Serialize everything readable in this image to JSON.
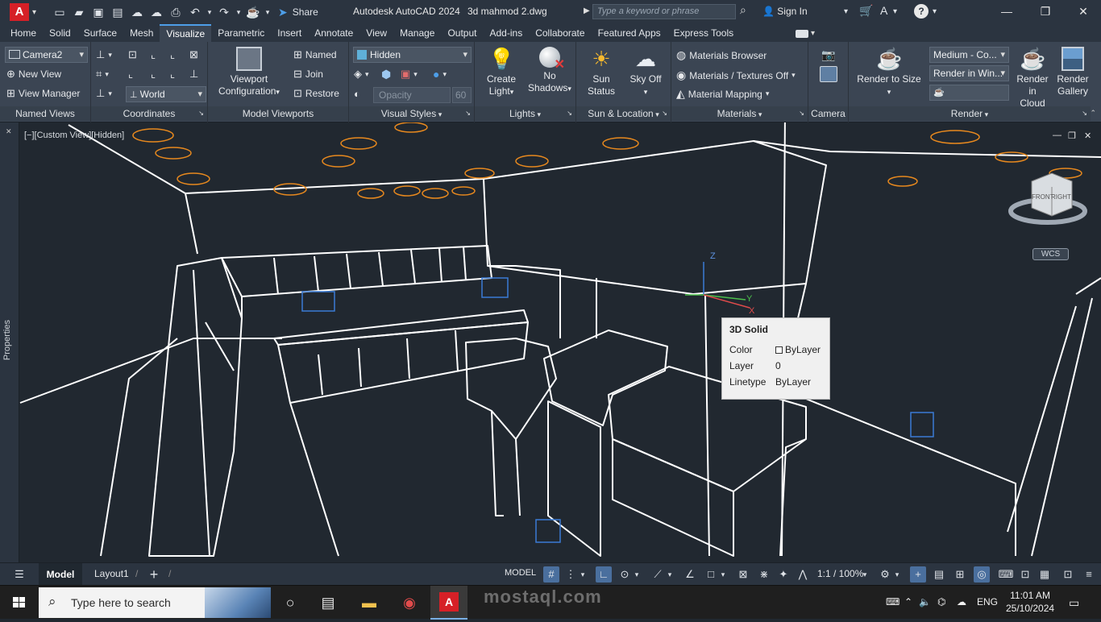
{
  "app": {
    "logo_letter": "A",
    "title": "Autodesk AutoCAD 2024",
    "file": "3d mahmod 2.dwg",
    "share_label": "Share",
    "search_placeholder": "Type a keyword or phrase",
    "signin_label": "Sign In"
  },
  "tabs": [
    "Home",
    "Solid",
    "Surface",
    "Mesh",
    "Visualize",
    "Parametric",
    "Insert",
    "Annotate",
    "View",
    "Manage",
    "Output",
    "Add-ins",
    "Collaborate",
    "Featured Apps",
    "Express Tools"
  ],
  "active_tab": "Visualize",
  "ribbon": {
    "named_views": {
      "title": "Named Views",
      "camera": "Camera2",
      "new_view": "New View",
      "view_manager": "View Manager"
    },
    "coordinates": {
      "title": "Coordinates",
      "ucs": "World"
    },
    "model_viewports": {
      "title": "Model Viewports",
      "config_line1": "Viewport",
      "config_line2": "Configuration",
      "named": "Named",
      "join": "Join",
      "restore": "Restore"
    },
    "visual_styles": {
      "title": "Visual Styles",
      "style": "Hidden",
      "opacity_label": "Opacity",
      "opacity_value": "60"
    },
    "lights": {
      "title": "Lights",
      "create_light_1": "Create",
      "create_light_2": "Light",
      "no_shadows_1": "No",
      "no_shadows_2": "Shadows"
    },
    "sun_location": {
      "title": "Sun & Location",
      "sun_1": "Sun",
      "sun_2": "Status",
      "sky_1": "Sky Off"
    },
    "materials": {
      "title": "Materials",
      "browser": "Materials Browser",
      "textures": "Materials / Textures Off",
      "mapping": "Material Mapping"
    },
    "camera": {
      "title": "Camera"
    },
    "render": {
      "title": "Render",
      "render_to_size": "Render to Size",
      "preset": "Medium - Co...",
      "render_in": "Render in Win...",
      "cloud_1": "Render in",
      "cloud_2": "Cloud",
      "gallery_1": "Render",
      "gallery_2": "Gallery"
    }
  },
  "viewport": {
    "label": "[−][Custom View][Hidden]",
    "properties_label": "Properties",
    "wcs_label": "WCS",
    "cube_front": "FRONT",
    "cube_right": "RIGHT",
    "axis_x": "X",
    "axis_y": "Y",
    "axis_z": "Z"
  },
  "tooltip": {
    "title": "3D Solid",
    "rows": [
      {
        "key": "Color",
        "value": "ByLayer"
      },
      {
        "key": "Layer",
        "value": "0"
      },
      {
        "key": "Linetype",
        "value": "ByLayer"
      }
    ]
  },
  "status": {
    "model_tab": "Model",
    "layout_tab": "Layout1",
    "model_mode": "MODEL",
    "scale": "1:1 / 100%"
  },
  "taskbar": {
    "search_placeholder": "Type here to search",
    "lang": "ENG",
    "time": "11:01 AM",
    "date": "25/10/2024"
  },
  "watermark": "mostaql.com",
  "colors": {
    "accent": "#4d9ee8",
    "autocad_red": "#d62027",
    "light_orange": "#e8891e",
    "ucs_blue": "#3a7bd5"
  }
}
